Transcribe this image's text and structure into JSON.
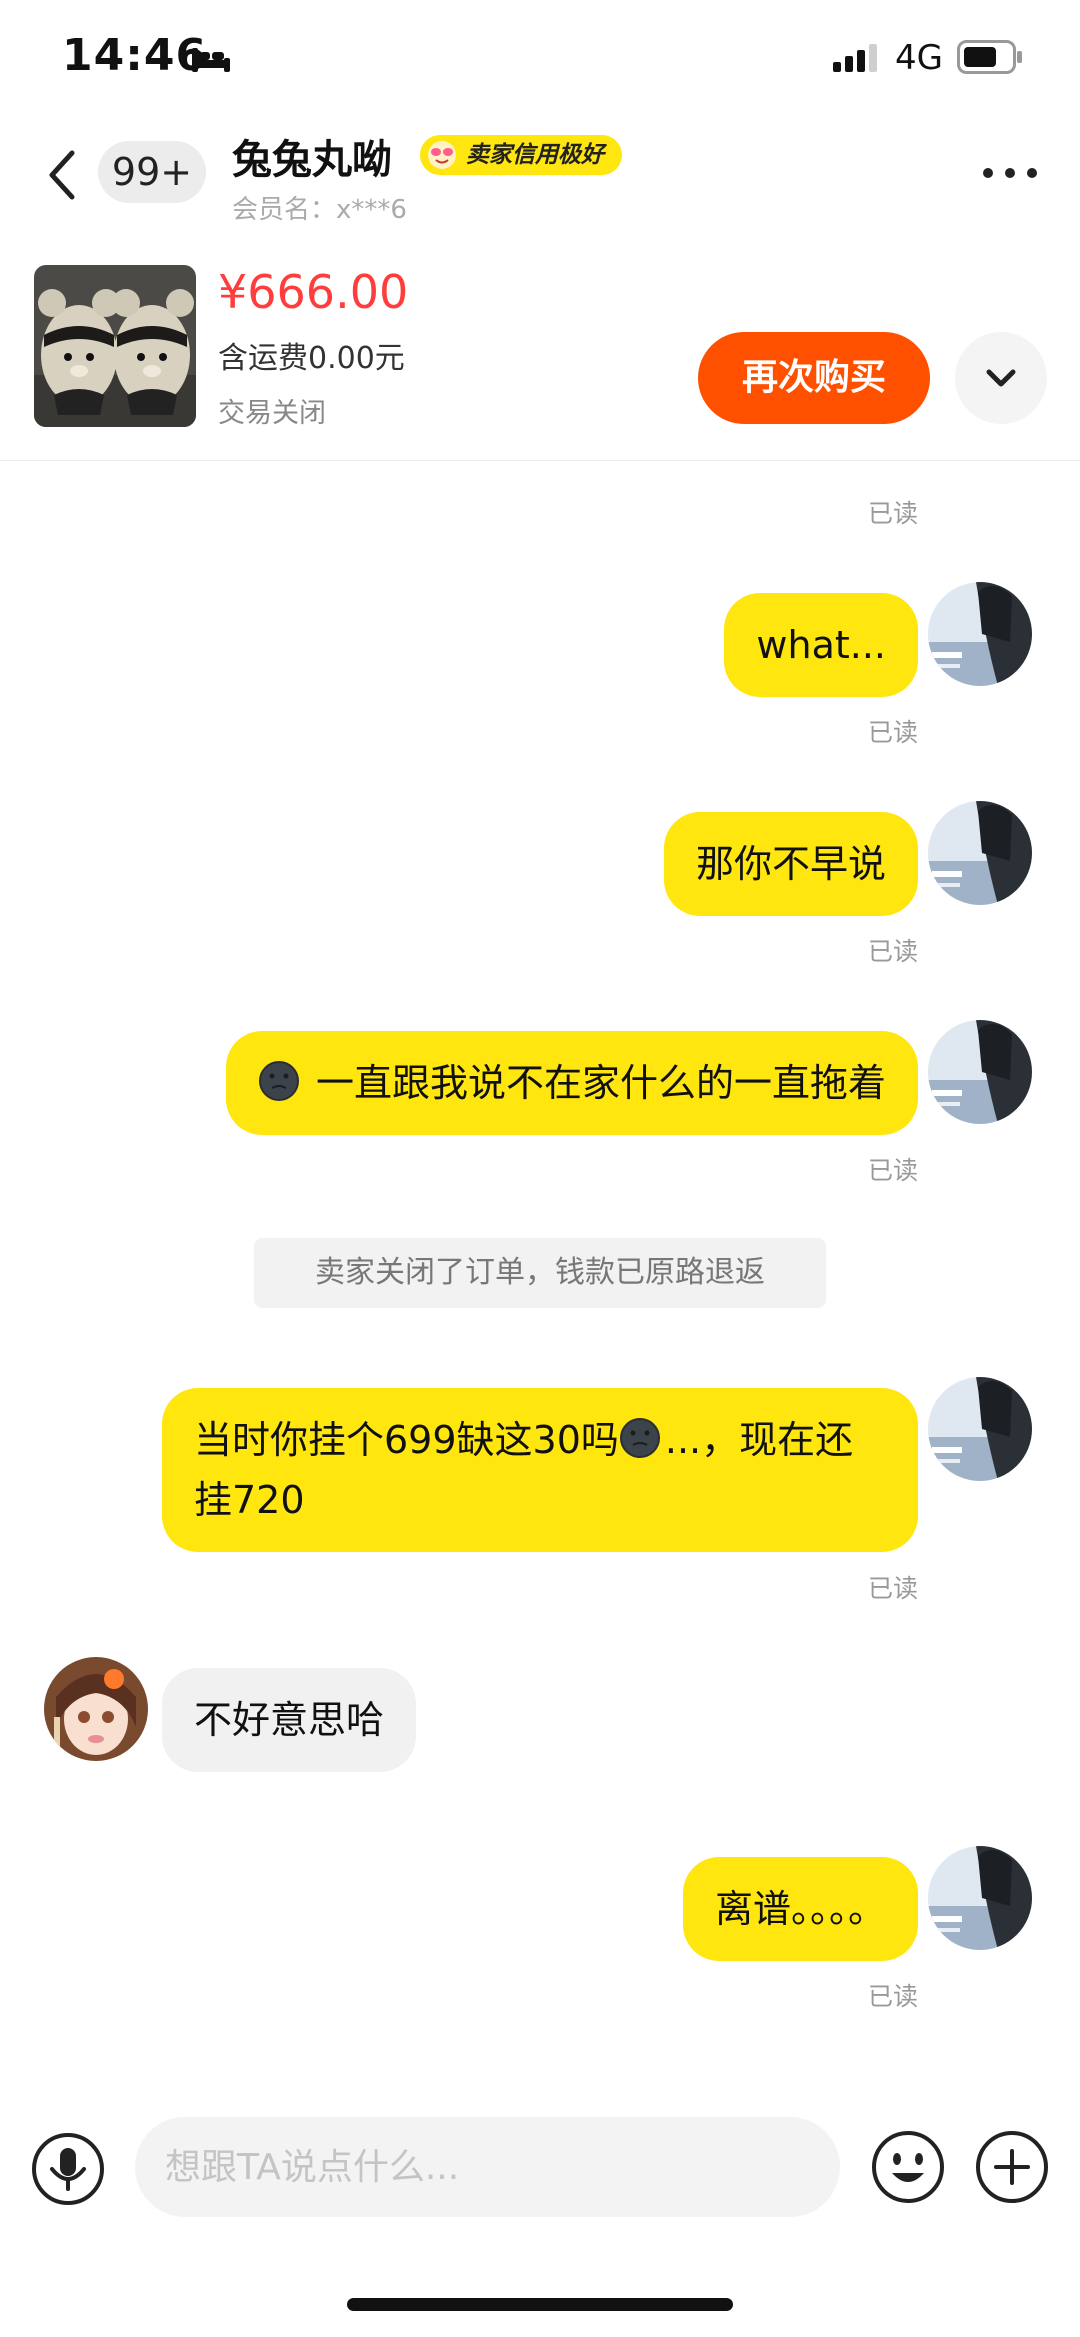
{
  "status_bar": {
    "time": "14:46",
    "network": "4G",
    "icons": [
      "bed-icon",
      "signal-icon",
      "battery-icon"
    ]
  },
  "header": {
    "unread_count": "99+",
    "seller_name": "兔兔丸呦",
    "credit_badge": "卖家信用极好",
    "member_label": "会员名：x***6",
    "icons": [
      "back-icon",
      "smiling-face-icon",
      "more-icon"
    ]
  },
  "product": {
    "price": "¥666.00",
    "shipping": "含运费0.00元",
    "status": "交易关闭",
    "rebuy_label": "再次购买",
    "price_color": "#ff3d3d",
    "button_color": "#ff5000"
  },
  "messages": {
    "read_label": "已读",
    "m1": "what...",
    "m2": "那你不早说",
    "m3": "一直跟我说不在家什么的一直拖着",
    "system_notice": "卖家关闭了订单，钱款已原路退返",
    "m4_part1": "当时你挂个699缺这30吗",
    "m4_part2": "...，现在还挂720",
    "seller_reply": "不好意思哈",
    "m5": "离谱。。。。"
  },
  "input": {
    "placeholder": "想跟TA说点什么...",
    "icons": [
      "microphone-icon",
      "emoji-icon",
      "plus-icon"
    ]
  },
  "colors": {
    "my_bubble": "#ffe60f",
    "seller_bubble": "#f1f1f1"
  }
}
